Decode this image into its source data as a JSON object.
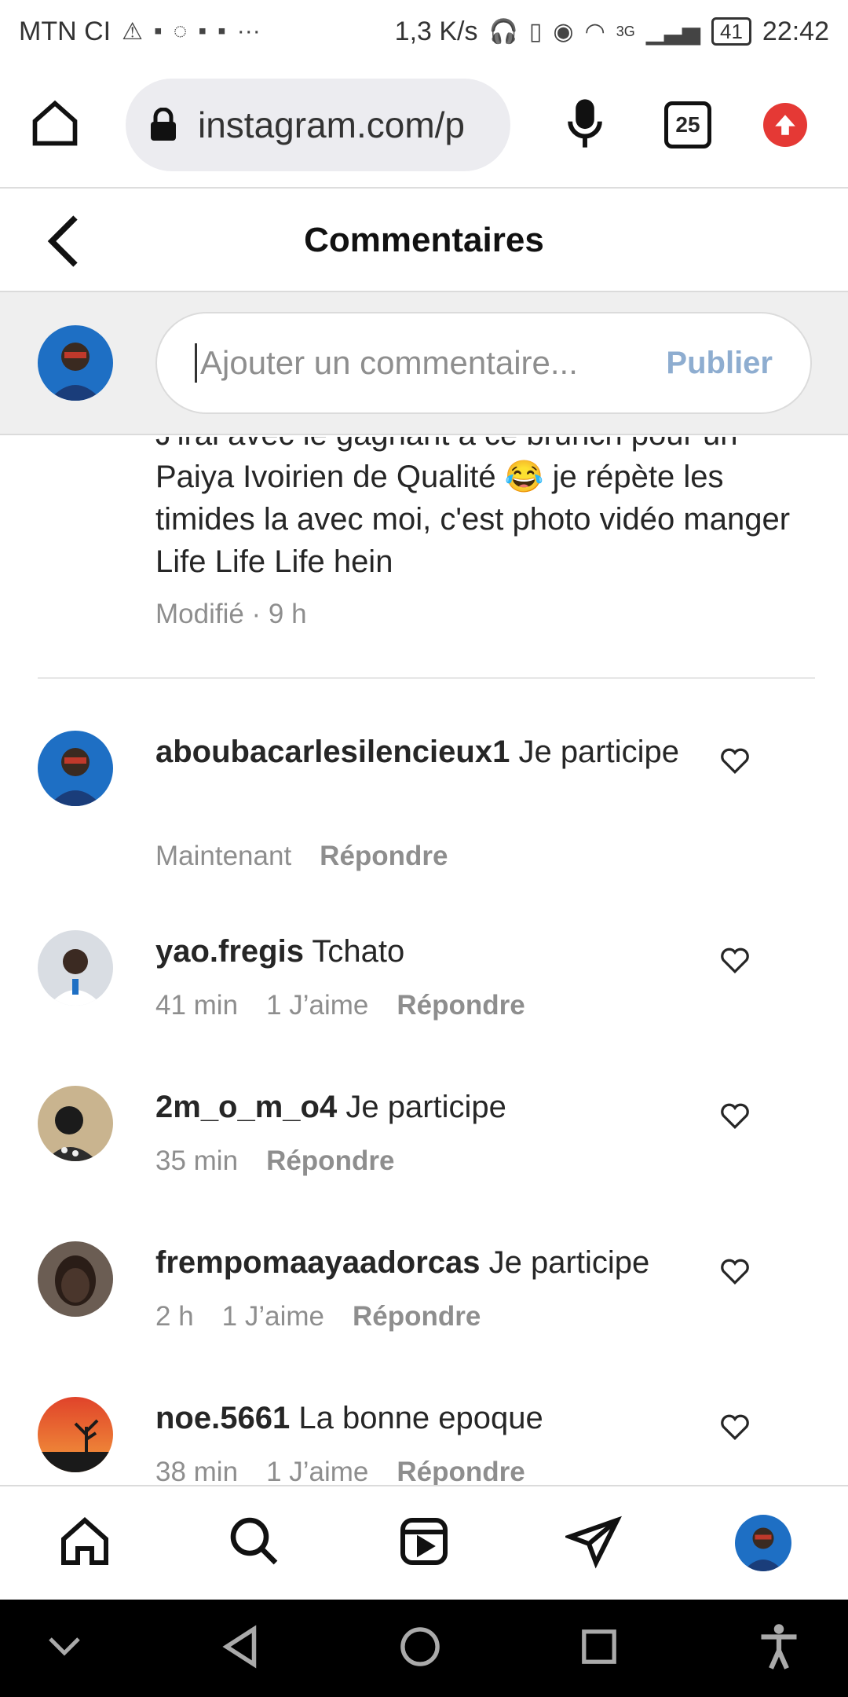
{
  "status_bar": {
    "carrier": "MTN CI",
    "speed": "1,3 K/s",
    "network": "3G",
    "battery": "41",
    "time": "22:42"
  },
  "browser": {
    "url": "instagram.com/p",
    "tab_count": "25"
  },
  "header": {
    "title": "Commentaires"
  },
  "composer": {
    "placeholder": "Ajouter un commentaire...",
    "publish_label": "Publier"
  },
  "caption": {
    "partial_line": "J'irai avec le gagnant à ce brunch pour un",
    "text": "Paiya Ivoirien de Qualité 😂 je répète les timides la avec moi, c'est photo vidéo manger Life Life Life hein",
    "meta": "Modifié · 9 h"
  },
  "comments": [
    {
      "username": "aboubacarlesilencieux1",
      "text": "Je participe",
      "time": "Maintenant",
      "likes": "",
      "reply": "Répondre"
    },
    {
      "username": "yao.fregis",
      "text": "Tchato",
      "time": "41 min",
      "likes": "1 J’aime",
      "reply": "Répondre"
    },
    {
      "username": "2m_o_m_o4",
      "text": "Je participe",
      "time": "35 min",
      "likes": "",
      "reply": "Répondre"
    },
    {
      "username": "frempomaayaadorcas",
      "text": "Je participe",
      "time": "2 h",
      "likes": "1 J’aime",
      "reply": "Répondre"
    },
    {
      "username": "noe.5661",
      "text": "La bonne epoque",
      "time": "38 min",
      "likes": "1 J’aime",
      "reply": "Répondre"
    }
  ],
  "colors": {
    "publish": "#8eadd0",
    "meta_text": "#8e8e8e",
    "upload_button": "#e53935"
  }
}
